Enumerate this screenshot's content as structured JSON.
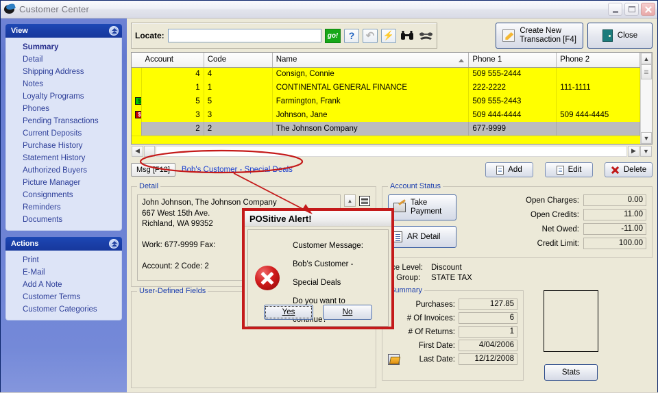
{
  "window": {
    "title": "Customer Center",
    "logo_icon": "positive-logo-icon",
    "minimize_label": "Minimize",
    "maximize_label": "Maximize",
    "close_label": "Close"
  },
  "sidebar": {
    "view_panel": {
      "title": "View",
      "collapse_icon": "chevron-up-icon",
      "items": [
        {
          "label": "Summary",
          "active": true
        },
        {
          "label": "Detail",
          "active": false
        },
        {
          "label": "Shipping Address",
          "active": false
        },
        {
          "label": "Notes",
          "active": false
        },
        {
          "label": "Loyalty Programs",
          "active": false
        },
        {
          "label": "Phones",
          "active": false
        },
        {
          "label": "Pending Transactions",
          "active": false
        },
        {
          "label": "Current Deposits",
          "active": false
        },
        {
          "label": "Purchase History",
          "active": false
        },
        {
          "label": "Statement History",
          "active": false
        },
        {
          "label": "Authorized Buyers",
          "active": false
        },
        {
          "label": "Picture Manager",
          "active": false
        },
        {
          "label": "Consignments",
          "active": false
        },
        {
          "label": "Reminders",
          "active": false
        },
        {
          "label": "Documents",
          "active": false
        }
      ]
    },
    "actions_panel": {
      "title": "Actions",
      "collapse_icon": "chevron-up-icon",
      "items": [
        {
          "label": "Print"
        },
        {
          "label": "E-Mail"
        },
        {
          "label": "Add A Note"
        },
        {
          "label": "Customer Terms"
        },
        {
          "label": "Customer Categories"
        }
      ]
    }
  },
  "toolbar": {
    "locate_label": "Locate:",
    "locate_value": "",
    "locate_placeholder": "",
    "go_label": "go!",
    "icons": [
      {
        "name": "help-icon",
        "glyph": "?"
      },
      {
        "name": "refresh-icon",
        "glyph": "↺"
      },
      {
        "name": "lightning-icon",
        "glyph": "⚡"
      },
      {
        "name": "binoculars-icon",
        "glyph": "🔭"
      },
      {
        "name": "telephone-icon",
        "glyph": "☎"
      }
    ],
    "create_new_line1": "Create New",
    "create_new_line2": "Transaction [F4]",
    "close_label": "Close"
  },
  "grid": {
    "columns": [
      "Account",
      "Code",
      "Name",
      "Phone 1",
      "Phone 2"
    ],
    "sort_column": "Name",
    "sort_indicator": "ascending",
    "rows": [
      {
        "indicator": "",
        "account": "4",
        "code": "4",
        "name": "Consign, Connie",
        "phone1": "509  555-2444",
        "phone2": "",
        "selected": false
      },
      {
        "indicator": "",
        "account": "1",
        "code": "1",
        "name": "CONTINENTAL GENERAL FINANCE",
        "phone1": "222-2222",
        "phone2": "111-1111",
        "selected": false
      },
      {
        "indicator": "green-money-icon",
        "account": "5",
        "code": "5",
        "name": "Farmington, Frank",
        "phone1": "509  555-2443",
        "phone2": "",
        "selected": false
      },
      {
        "indicator": "red-money-icon",
        "account": "3",
        "code": "3",
        "name": "Johnson, Jane",
        "phone1": "509  444-4444",
        "phone2": "509  444-4445",
        "selected": false
      },
      {
        "indicator": "",
        "account": "2",
        "code": "2",
        "name": "The Johnson Company",
        "phone1": "677-9999",
        "phone2": "",
        "selected": true
      }
    ]
  },
  "msgrow": {
    "msg_button": "Msg [F12]",
    "message_link": "Bob's Customer - Special Deals",
    "add_label": "Add",
    "edit_label": "Edit",
    "delete_label": "Delete"
  },
  "detail": {
    "legend": "Detail",
    "text": "John Johnson, The Johnson Company\n667 West 15th Ave.\nRichland, WA  99352\n\nWork: 677-9999   Fax:\n\nAccount: 2 Code: 2"
  },
  "user_defined": {
    "legend": "User-Defined Fields"
  },
  "account_status": {
    "legend": "Account Status",
    "take_payment_line1": "Take",
    "take_payment_line2": "Payment",
    "ar_detail_label": "AR Detail",
    "fields": [
      {
        "label": "Open Charges:",
        "value": "0.00"
      },
      {
        "label": "Open Credits:",
        "value": "11.00"
      },
      {
        "label": "Net Owed:",
        "value": "-11.00"
      },
      {
        "label": "Credit Limit:",
        "value": "100.00"
      }
    ],
    "price_level_label": "Price Level:",
    "price_level_value": "Discount",
    "tax_group_label": "Tax Group:",
    "tax_group_value": "STATE TAX"
  },
  "summary": {
    "legend": "Summary",
    "rows": [
      {
        "label": "Purchases:",
        "value": "127.85",
        "icon": ""
      },
      {
        "label": "# Of Invoices:",
        "value": "6",
        "icon": ""
      },
      {
        "label": "# Of Returns:",
        "value": "1",
        "icon": ""
      },
      {
        "label": "First Date:",
        "value": "4/04/2006",
        "icon": ""
      },
      {
        "label": "Last Date:",
        "value": "12/12/2008",
        "icon": "book-icon"
      }
    ],
    "stats_label": "Stats"
  },
  "modal": {
    "title": "POSitive Alert!",
    "icon": "error-x-icon",
    "line1": "Customer Message:",
    "line2": "Bob's Customer - Special Deals",
    "line3": "Do you want to continue?",
    "yes_label": "Yes",
    "no_label": "No"
  },
  "colors": {
    "grid_highlight": "#ffff00",
    "grid_selected": "#bcbcbc",
    "annotation": "#c41a1a",
    "link": "#1a3fd0",
    "panel_header": "#1a3fa8"
  }
}
